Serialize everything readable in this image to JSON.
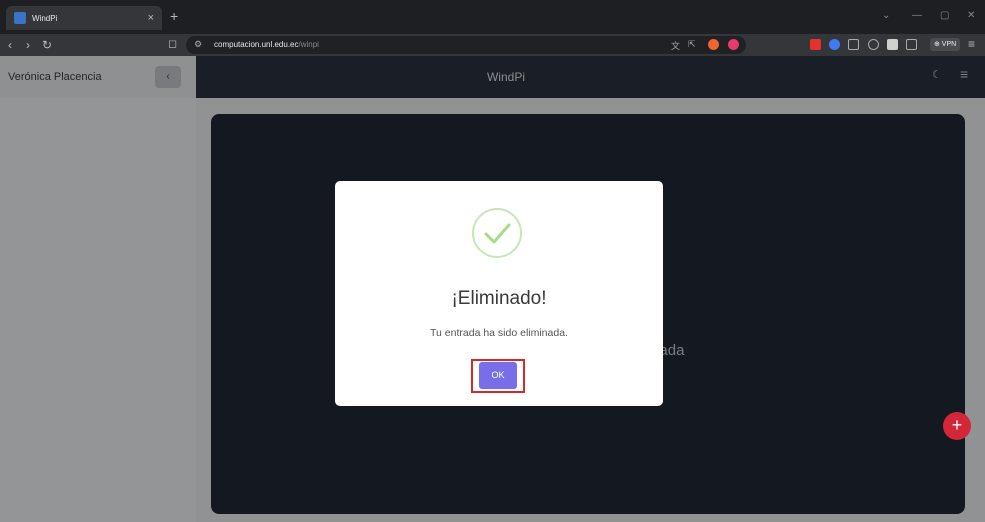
{
  "browser": {
    "tab_title": "WindPi",
    "tab_close": "×",
    "new_tab": "+",
    "url_host": "computacion.unl.edu.ec",
    "url_path": "/winpi",
    "vpn_label": "⊕ VPN",
    "icons": [
      "back-icon",
      "forward-icon",
      "reload-icon",
      "bookmark-icon",
      "site-info-icon",
      "menu-icon"
    ]
  },
  "sidebar": {
    "user_name": "Verónica Placencia",
    "collapse_label": "‹"
  },
  "topbar": {
    "title": "WindPi"
  },
  "main": {
    "empty_text": "Tu entrada ha sido eliminada"
  },
  "fab": {
    "label": "+"
  },
  "modal": {
    "title": "¡Eliminado!",
    "text": "Tu entrada ha sido eliminada.",
    "ok_label": "OK",
    "icon": "check-circle-icon"
  },
  "colors": {
    "topbar": "#2a3342",
    "card": "#222a37",
    "ok_button": "#7a6ee8",
    "fab": "#d42638",
    "success": "#a5dc86"
  }
}
